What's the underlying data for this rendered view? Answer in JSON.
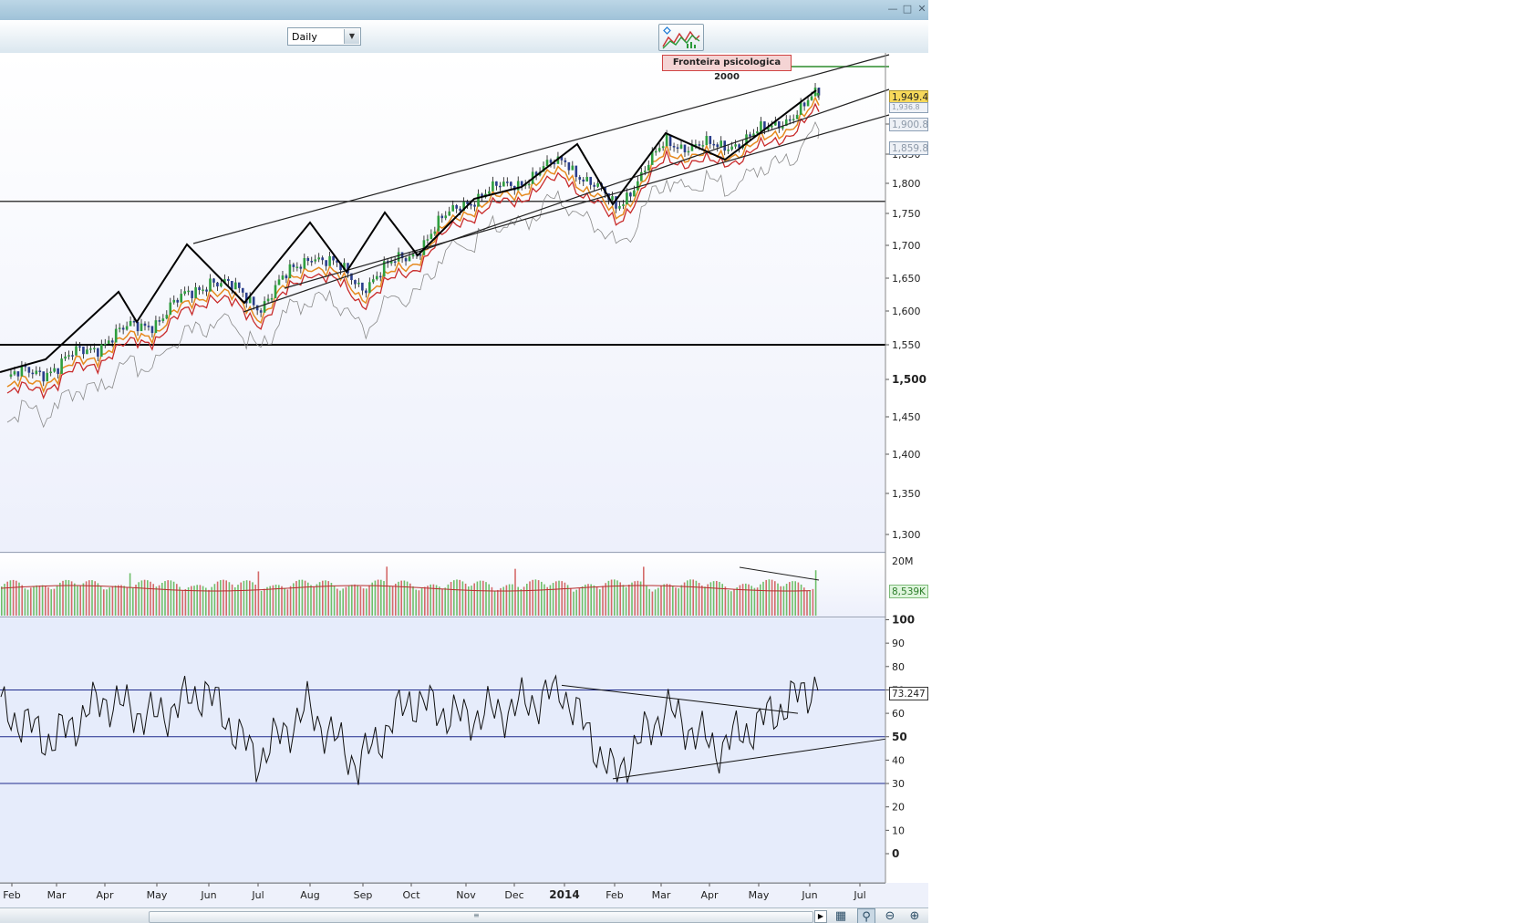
{
  "toolbar": {
    "period_value": "Daily",
    "period_options": [
      "Daily"
    ],
    "chart_style_icon": "chart-style-icon"
  },
  "window": {
    "minimize_icon": "minimize-icon",
    "maximize_icon": "maximize-icon",
    "close_icon": "close-icon"
  },
  "annotation": {
    "text": "Fronteira psicologica 2000"
  },
  "price_axis": {
    "ticks": [
      "1,950",
      "1,900",
      "1,850",
      "1,800",
      "1,750",
      "1,700",
      "1,650",
      "1,600",
      "1,550",
      "1,500",
      "1,450",
      "1,400",
      "1,350",
      "1,300"
    ],
    "highlighted_tick": "1,500"
  },
  "price_tags": {
    "last": "1,949.44",
    "upper_hidden": "1,936.8",
    "ma": "1,900.8",
    "low": "1,859.8"
  },
  "volume_axis": {
    "top_label": "20M",
    "tag": "8,539K"
  },
  "rsi_axis": {
    "ticks": [
      "100",
      "90",
      "80",
      "70",
      "60",
      "50",
      "40",
      "30",
      "20",
      "10",
      "0"
    ],
    "bold_ticks": [
      "100",
      "50",
      "0"
    ],
    "tag": "73.247"
  },
  "time_axis": {
    "labels": [
      "Feb",
      "Mar",
      "Apr",
      "May",
      "Jun",
      "Jul",
      "Aug",
      "Sep",
      "Oct",
      "Nov",
      "Dec",
      "2014",
      "Feb",
      "Mar",
      "Apr",
      "May",
      "Jun",
      "Jul"
    ],
    "bold_label": "2014"
  },
  "scrollbar": {
    "tools": [
      "indicator-icon",
      "zoom-select-icon",
      "zoom-out-icon",
      "zoom-in-icon"
    ]
  },
  "colors": {
    "bull": "#2e9e3e",
    "bear": "#d43a3a",
    "ma_short": "#e68a1f",
    "ma_long": "#c92b2b",
    "trend": "#111111",
    "last_price_tag": "#f7d95a",
    "psych_line": "#2c8c2c"
  },
  "chart_data": [
    {
      "type": "line",
      "title": "",
      "xlabel": "",
      "ylabel": "",
      "ylim": [
        1280,
        1970
      ],
      "x": [
        "Feb 2013",
        "Mar",
        "Apr",
        "May",
        "Jun",
        "Jul",
        "Aug",
        "Sep",
        "Oct",
        "Nov",
        "Dec",
        "2014",
        "Feb",
        "Mar",
        "Apr",
        "May",
        "Jun"
      ],
      "series": [
        {
          "values": [
            1500,
            1520,
            1560,
            1590,
            1650,
            1610,
            1690,
            1640,
            1690,
            1770,
            1800,
            1840,
            1760,
            1870,
            1860,
            1890,
            1949
          ]
        }
      ],
      "horizontal_levels": [
        1550,
        1770,
        2000
      ],
      "annotation": "Fronteira psicologica 2000",
      "last_value": 1949.44,
      "grid": false
    },
    {
      "type": "bar",
      "title": "",
      "ylim": [
        0,
        20000000
      ],
      "last_value_label": "8,539K"
    },
    {
      "type": "line",
      "title": "",
      "ylim": [
        0,
        100
      ],
      "x": [
        "Feb 2013",
        "Mar",
        "Apr",
        "May",
        "Jun",
        "Jul",
        "Aug",
        "Sep",
        "Oct",
        "Nov",
        "Dec",
        "2014",
        "Feb",
        "Mar",
        "Apr",
        "May",
        "Jun"
      ],
      "series": [
        {
          "values": [
            62,
            48,
            66,
            58,
            70,
            40,
            62,
            38,
            66,
            58,
            62,
            70,
            33,
            62,
            45,
            58,
            73.2
          ]
        }
      ],
      "horizontal_levels": [
        30,
        50,
        70
      ],
      "last_value": 73.247,
      "grid": false
    }
  ]
}
